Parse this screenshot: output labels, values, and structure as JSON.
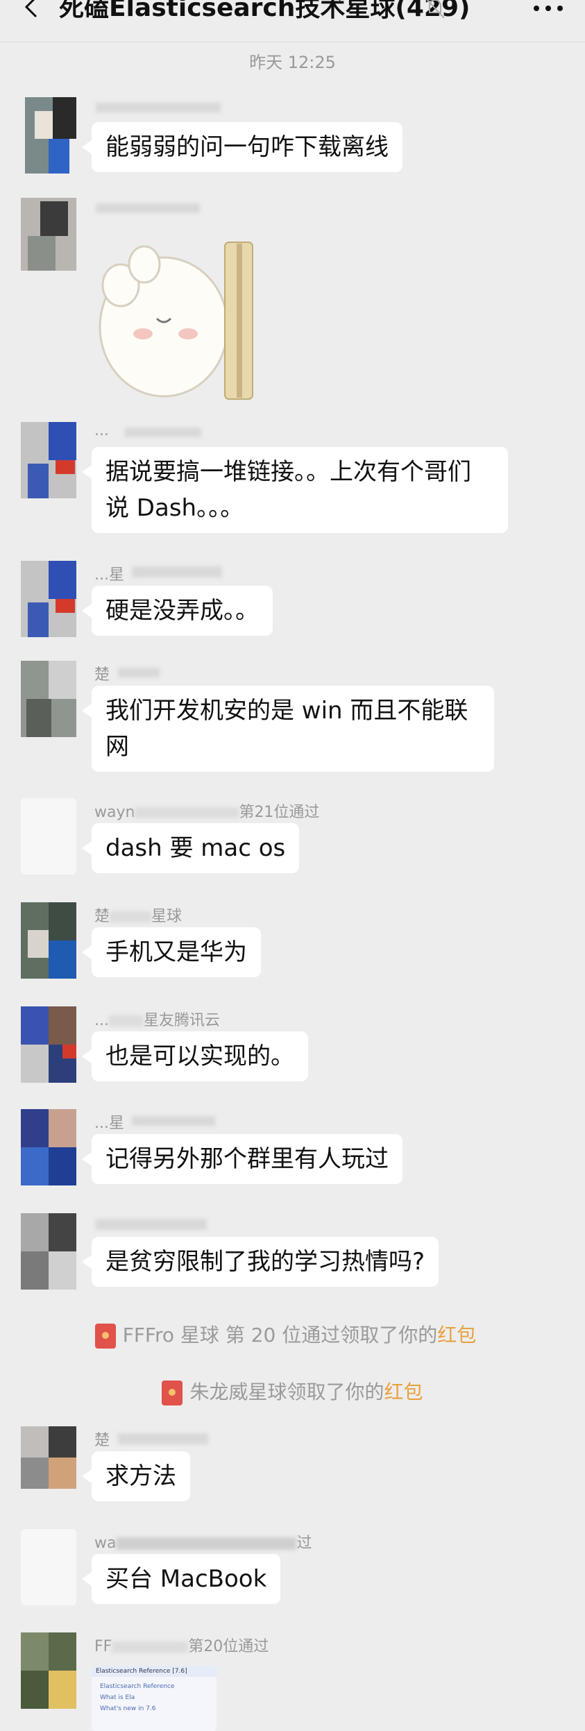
{
  "header": {
    "title": "死磕Elasticsearch技术星球(429)",
    "back_icon": "back-arrow-icon",
    "mute_icon": "bell-muted-icon",
    "more_icon": "more-dots-icon"
  },
  "timestamp": "昨天 12:25",
  "messages": [
    {
      "sender": "",
      "text": "能弱弱的问一句咋下载离线"
    },
    {
      "sender": "",
      "text": "",
      "sticker": "cartoon-sticker"
    },
    {
      "sender": "...",
      "text": "据说要搞一堆链接。。上次有个哥们说 Dash。。。"
    },
    {
      "sender": "...星",
      "text": "硬是没弄成。。"
    },
    {
      "sender": "楚",
      "text": "我们开发机安的是 win 而且不能联网"
    },
    {
      "sender": "wayn",
      "sender_suffix": "第21位通过",
      "text": "dash 要 mac os"
    },
    {
      "sender": "楚",
      "sender_suffix": "星球",
      "text": "手机又是华为"
    },
    {
      "sender": "...",
      "sender_suffix": "星友腾讯云",
      "text": "也是可以实现的。"
    },
    {
      "sender": "...星",
      "text": "记得另外那个群里有人玩过"
    },
    {
      "sender": "",
      "text": "是贫穷限制了我的学习热情吗?"
    },
    {
      "sender": "楚",
      "text": "求方法"
    },
    {
      "sender": "wa",
      "sender_suffix": "过",
      "text": "买台 MacBook"
    },
    {
      "sender": "FF",
      "sender_suffix": "第20位通过",
      "text": ""
    }
  ],
  "system_notices": [
    {
      "prefix": "FFFro  星球 第 20 位通过领取了你的",
      "link": "红包"
    },
    {
      "prefix": "朱龙威星球领取了你的",
      "link": "红包"
    }
  ],
  "thumbnail": {
    "title": "Elasticsearch Reference [7.6]",
    "lines": [
      "Elasticsearch Reference",
      "What is Ela",
      "What's new in 7.6"
    ]
  },
  "colors": {
    "background": "#ededed",
    "bubble": "#ffffff",
    "red_packet_link": "#e9a040"
  }
}
